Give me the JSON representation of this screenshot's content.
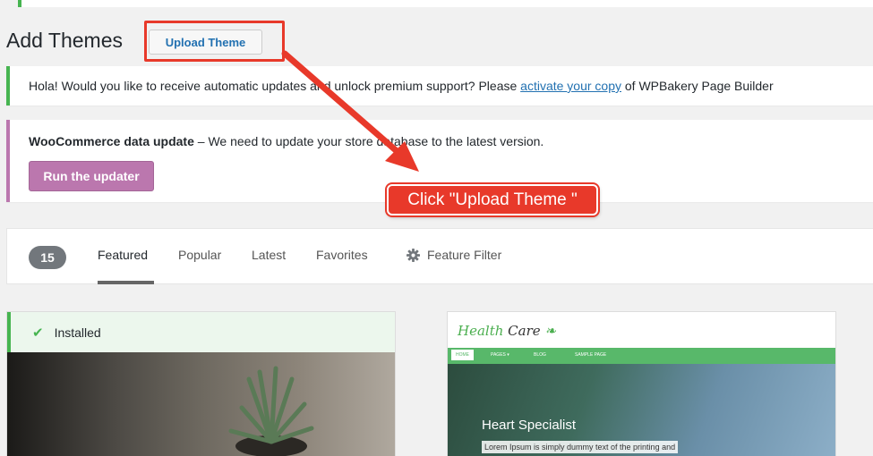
{
  "header": {
    "page_title": "Add Themes",
    "upload_button": "Upload Theme"
  },
  "notices": {
    "wpbakery": {
      "before_link": "Hola! Would you like to receive automatic updates and unlock premium support? Please ",
      "link": "activate your copy",
      "after_link": " of WPBakery Page Builder"
    },
    "woocommerce": {
      "title": "WooCommerce data update",
      "message": " – We need to update your store database to the latest version.",
      "button": "Run the updater"
    }
  },
  "annotation": {
    "callout": "Click \"Upload Theme \""
  },
  "filter_bar": {
    "count": "15",
    "tabs": [
      "Featured",
      "Popular",
      "Latest",
      "Favorites"
    ],
    "active_tab": "Featured",
    "feature_filter": "Feature Filter"
  },
  "themes": [
    {
      "status": "Installed"
    },
    {
      "logo_health": "Health",
      "logo_care": "Care",
      "nav": [
        "HOME",
        "PAGES ▾",
        "BLOG",
        "SAMPLE PAGE"
      ],
      "hero_title": "Heart Specialist",
      "hero_text": "Lorem Ipsum is simply dummy text of the printing and"
    }
  ],
  "colors": {
    "accent_blue": "#2271b1",
    "success_green": "#46b450",
    "woo_purple": "#bb77ae",
    "callout_red": "#e8392a"
  }
}
